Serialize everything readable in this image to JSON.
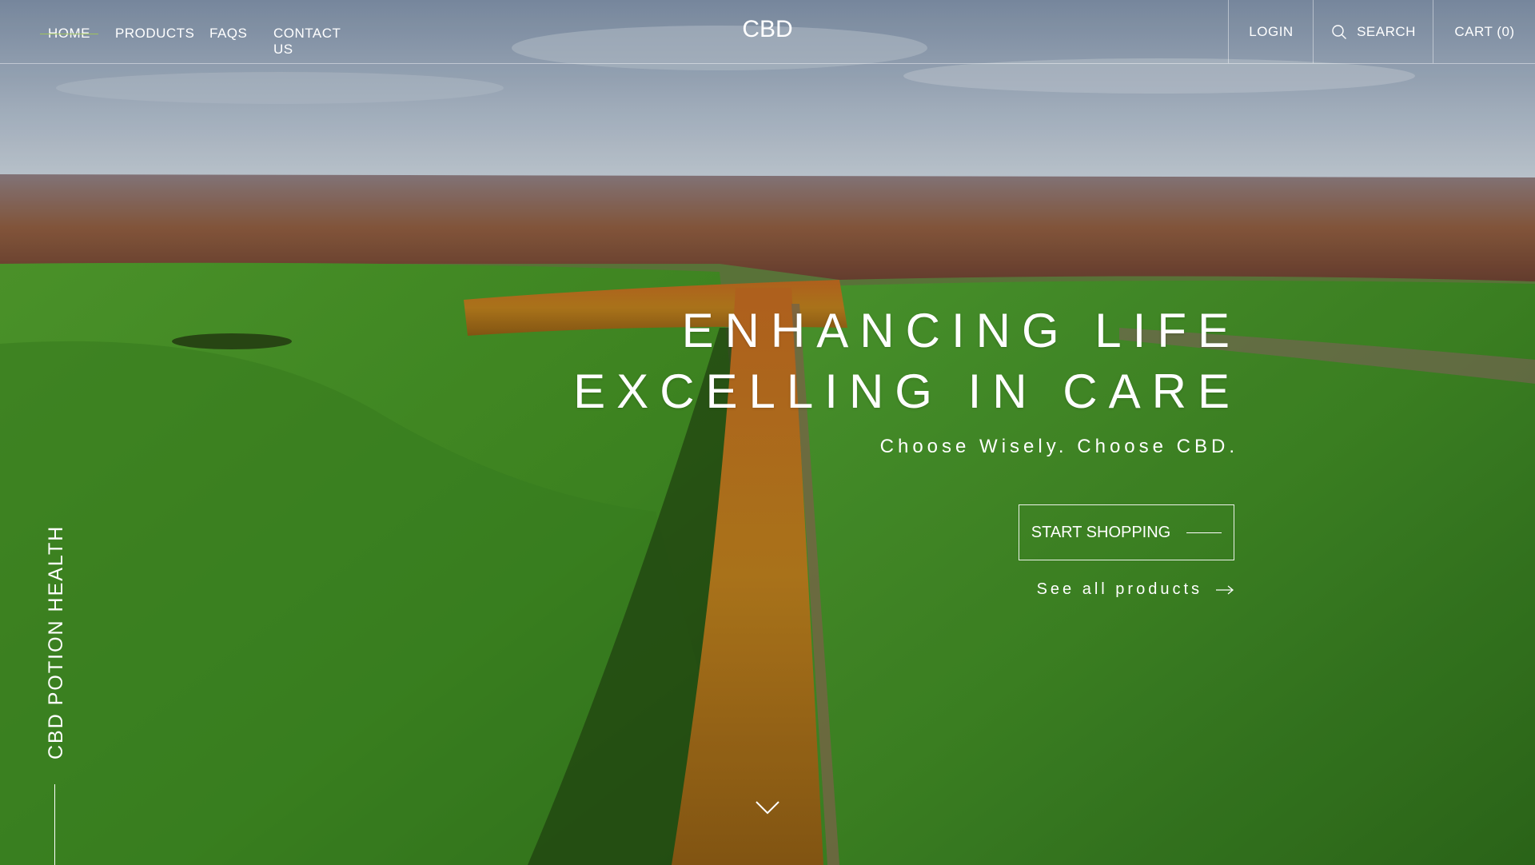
{
  "header": {
    "nav": [
      {
        "label": "HOME",
        "active": true
      },
      {
        "label": "PRODUCTS"
      },
      {
        "label": "FAQS"
      },
      {
        "label": "CONTACT US"
      }
    ],
    "logo": "CBD",
    "login_label": "LOGIN",
    "search_label": "SEARCH",
    "cart_label": "CART (0)"
  },
  "hero": {
    "headline_line1": "ENHANCING LIFE",
    "headline_line2": "EXCELLING IN CARE",
    "subheadline": "Choose Wisely. Choose CBD.",
    "cta_label": "START SHOPPING",
    "secondary_link": "See all products",
    "vertical_brand": "CBD POTION HEALTH"
  },
  "icons": {
    "search": "search-icon",
    "arrow": "arrow-right-icon",
    "scroll": "chevron-down-icon"
  },
  "colors": {
    "active_nav_accent": "#9fc25c",
    "text": "#ffffff"
  }
}
